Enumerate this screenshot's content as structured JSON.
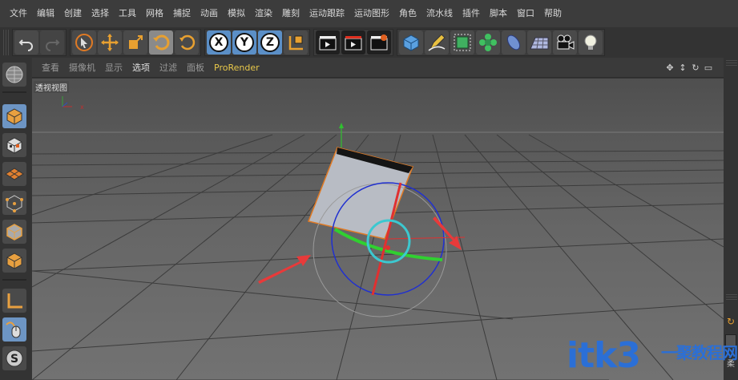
{
  "menu": {
    "items": [
      "文件",
      "编辑",
      "创建",
      "选择",
      "工具",
      "网格",
      "捕捉",
      "动画",
      "模拟",
      "渲染",
      "雕刻",
      "运动跟踪",
      "运动图形",
      "角色",
      "流水线",
      "插件",
      "脚本",
      "窗口",
      "帮助"
    ]
  },
  "toolbar": {
    "undo": "undo-icon",
    "redo": "redo-icon",
    "axis_x": "X",
    "axis_y": "Y",
    "axis_z": "Z"
  },
  "viewport": {
    "menu": [
      "查看",
      "摄像机",
      "显示",
      "选项",
      "过滤",
      "面板",
      "ProRender"
    ],
    "active_menu": "选项",
    "label": "透视视图"
  },
  "right_panel": {
    "label": "柔"
  },
  "watermark": {
    "main": "itk3",
    "sub": "一聚教程网"
  },
  "colors": {
    "accent_orange": "#e07a24",
    "x_axis": "#e03030",
    "y_axis": "#30c030",
    "z_axis": "#2030d0",
    "selection": "#3cc8d0"
  }
}
